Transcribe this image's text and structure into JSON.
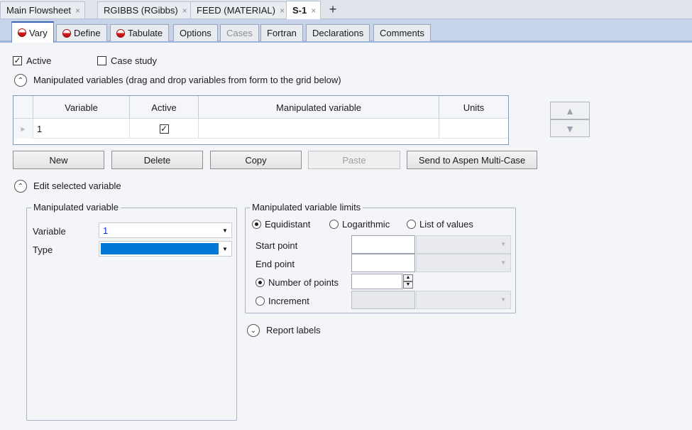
{
  "doc_tabs": [
    {
      "label": "Main Flowsheet"
    },
    {
      "label": "RGIBBS (RGibbs)"
    },
    {
      "label": "FEED (MATERIAL)"
    },
    {
      "label": "S-1"
    }
  ],
  "form_tabs": [
    {
      "label": "Vary"
    },
    {
      "label": "Define"
    },
    {
      "label": "Tabulate"
    },
    {
      "label": "Options"
    },
    {
      "label": "Cases"
    },
    {
      "label": "Fortran"
    },
    {
      "label": "Declarations"
    },
    {
      "label": "Comments"
    }
  ],
  "options": {
    "active_label": "Active",
    "active_checked": true,
    "case_study_label": "Case study",
    "case_study_checked": false
  },
  "manipulated_section": {
    "title": "Manipulated variables (drag and drop variables from form to the grid below)"
  },
  "grid": {
    "headers": {
      "variable": "Variable",
      "active": "Active",
      "manipulated": "Manipulated variable",
      "units": "Units"
    },
    "rows": [
      {
        "variable": "1",
        "active": true,
        "manipulated": "",
        "units": ""
      }
    ]
  },
  "buttons": {
    "new": "New",
    "delete": "Delete",
    "copy": "Copy",
    "paste": "Paste",
    "send": "Send to Aspen Multi-Case"
  },
  "edit_section": {
    "title": "Edit selected variable"
  },
  "mv_group": {
    "title": "Manipulated variable",
    "variable_label": "Variable",
    "variable_value": "1",
    "type_label": "Type",
    "type_value": ""
  },
  "limits_group": {
    "title": "Manipulated variable limits",
    "equidistant": "Equidistant",
    "logarithmic": "Logarithmic",
    "list_of_values": "List of values",
    "start_point": "Start point",
    "end_point": "End point",
    "number_of_points": "Number of points",
    "increment": "Increment"
  },
  "report_labels": {
    "title": "Report labels"
  },
  "icons": {
    "close": "×",
    "add": "+",
    "check": "✓",
    "up": "▲",
    "down": "▼",
    "collapse": "⌃",
    "expand": "⌄"
  },
  "colors": {
    "accent": "#0078d7",
    "band": "#c6d3e8",
    "value_text": "#0c2fc4"
  }
}
